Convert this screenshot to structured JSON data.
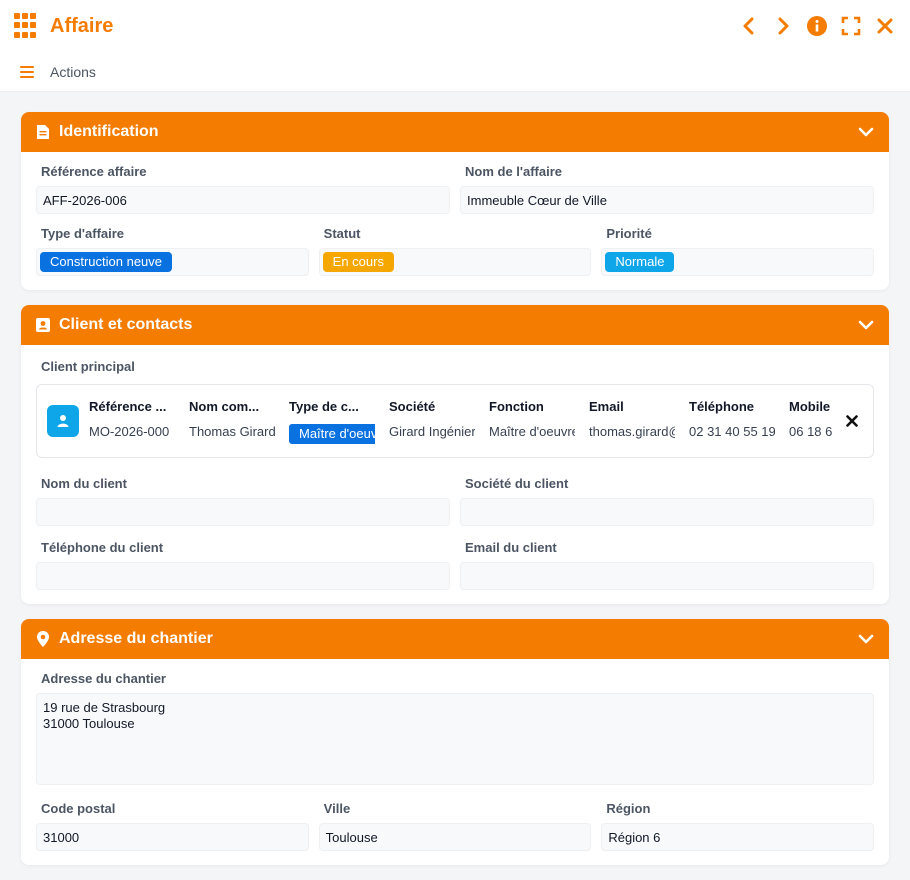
{
  "window": {
    "title": "Affaire",
    "accent": "#f47c00",
    "icons": [
      "grid-icon",
      "chevron-left-icon",
      "chevron-right-icon",
      "info-icon",
      "fullscreen-icon",
      "close-icon"
    ]
  },
  "toolbar": {
    "actions_label": "Actions"
  },
  "identification": {
    "title": "Identification",
    "reference_label": "Référence affaire",
    "reference_value": "AFF-2026-006",
    "name_label": "Nom de l'affaire",
    "name_value": "Immeuble Cœur de Ville",
    "type_label": "Type d'affaire",
    "type_value": "Construction neuve",
    "type_color": "#0a72e0",
    "status_label": "Statut",
    "status_value": "En cours",
    "status_color": "#f5a700",
    "priority_label": "Priorité",
    "priority_value": "Normale",
    "priority_color": "#0ea5e9"
  },
  "client": {
    "title": "Client et contacts",
    "main_client_label": "Client principal",
    "columns": [
      {
        "header": "Référence ...",
        "value": "MO-2026-000"
      },
      {
        "header": "Nom com...",
        "value": "Thomas Girard"
      },
      {
        "header": "Type de c...",
        "value": "Maître d'oeuvre",
        "badge": true
      },
      {
        "header": "Société",
        "value": "Girard Ingénierie"
      },
      {
        "header": "Fonction",
        "value": "Maître d'oeuvre"
      },
      {
        "header": "Email",
        "value": "thomas.girard@"
      },
      {
        "header": "Téléphone",
        "value": "02 31 40 55 19"
      },
      {
        "header": "Mobile",
        "value": "06 18 6"
      }
    ],
    "client_type_badge_color": "#0a72e0",
    "client_name_label": "Nom du client",
    "client_name_value": "",
    "client_company_label": "Société du client",
    "client_company_value": "",
    "client_phone_label": "Téléphone du client",
    "client_phone_value": "",
    "client_email_label": "Email du client",
    "client_email_value": ""
  },
  "address": {
    "title": "Adresse du chantier",
    "address_label": "Adresse du chantier",
    "address_value": "19 rue de Strasbourg\n31000 Toulouse",
    "postal_label": "Code postal",
    "postal_value": "31000",
    "city_label": "Ville",
    "city_value": "Toulouse",
    "region_label": "Région",
    "region_value": "Région 6"
  }
}
